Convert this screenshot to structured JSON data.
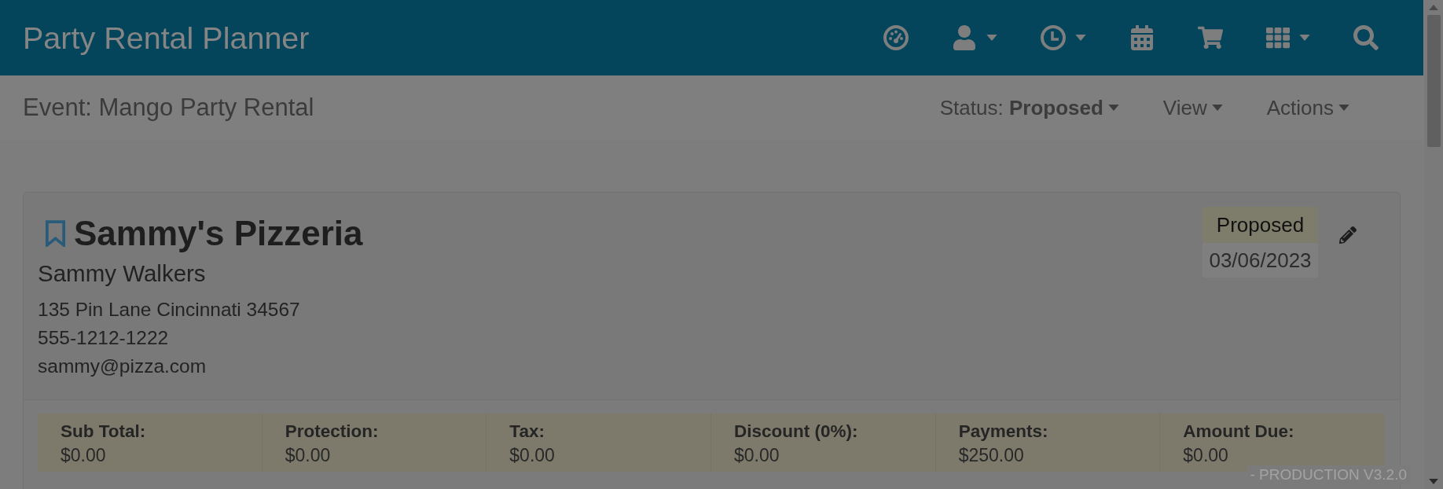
{
  "navbar": {
    "title": "Party Rental Planner",
    "icons": [
      {
        "kind": "gauge",
        "dropdown": false
      },
      {
        "kind": "user",
        "dropdown": true
      },
      {
        "kind": "clock",
        "dropdown": true
      },
      {
        "kind": "calendar",
        "dropdown": false
      },
      {
        "kind": "cart",
        "dropdown": false
      },
      {
        "kind": "grid",
        "dropdown": true
      },
      {
        "kind": "search",
        "dropdown": false
      }
    ]
  },
  "subheader": {
    "title": "Event: Mango Party Rental",
    "menus": [
      {
        "label": "Status: **Proposed**"
      },
      {
        "label": "View"
      },
      {
        "label": "Actions"
      }
    ]
  },
  "event_card": {
    "customer": "Sammy's Pizzeria",
    "contact": "Sammy Walkers",
    "address": "135 Pin Lane Cincinnati 34567",
    "phone": "555-1212-1222",
    "email": "sammy@pizza.com",
    "status": "Proposed",
    "date": "03/06/2023",
    "totals": [
      {
        "label": "Sub Total:",
        "value": "$0.00"
      },
      {
        "label": "Protection:",
        "value": "$0.00"
      },
      {
        "label": "Tax:",
        "value": "$0.00"
      },
      {
        "label": "Discount (0%):",
        "value": "$0.00"
      },
      {
        "label": "Payments:",
        "value": "$250.00"
      },
      {
        "label": "Amount Due:",
        "value": "$0.00"
      }
    ]
  },
  "footer": {
    "version": "- PRODUCTION V3.2.0"
  }
}
